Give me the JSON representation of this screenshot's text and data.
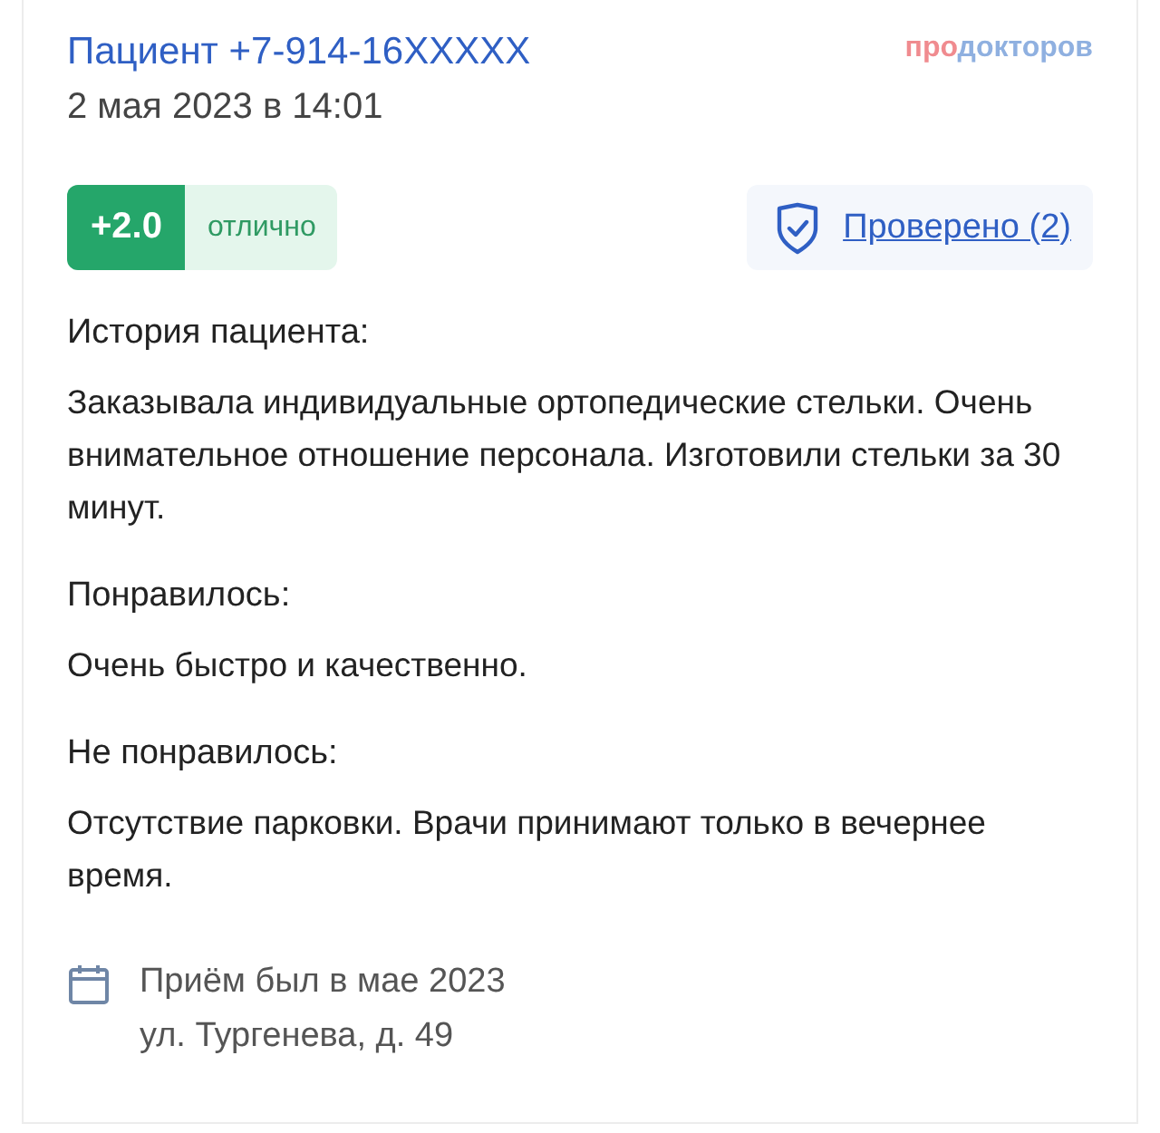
{
  "review": {
    "author": "Пациент +7-914-16XXXXX",
    "date": "2 мая 2023 в 14:01",
    "logo": {
      "prefix": "про",
      "rest": "докторов"
    },
    "score": {
      "value": "+2.0",
      "label": "отлично"
    },
    "verified": {
      "label": "Проверено (2)"
    },
    "sections": [
      {
        "heading": "История пациента:",
        "text": "Заказывала индивидуальные ортопедические стельки. Очень внимательное отношение персонала. Изготовили стельки за 30 минут."
      },
      {
        "heading": "Понравилось:",
        "text": "Очень быстро и качественно."
      },
      {
        "heading": "Не понравилось:",
        "text": "Отсутствие парковки. Врачи принимают только в вечернее время."
      }
    ],
    "visit": {
      "when": "Приём был в мае 2023",
      "address": "ул. Тургенева, д. 49"
    }
  }
}
